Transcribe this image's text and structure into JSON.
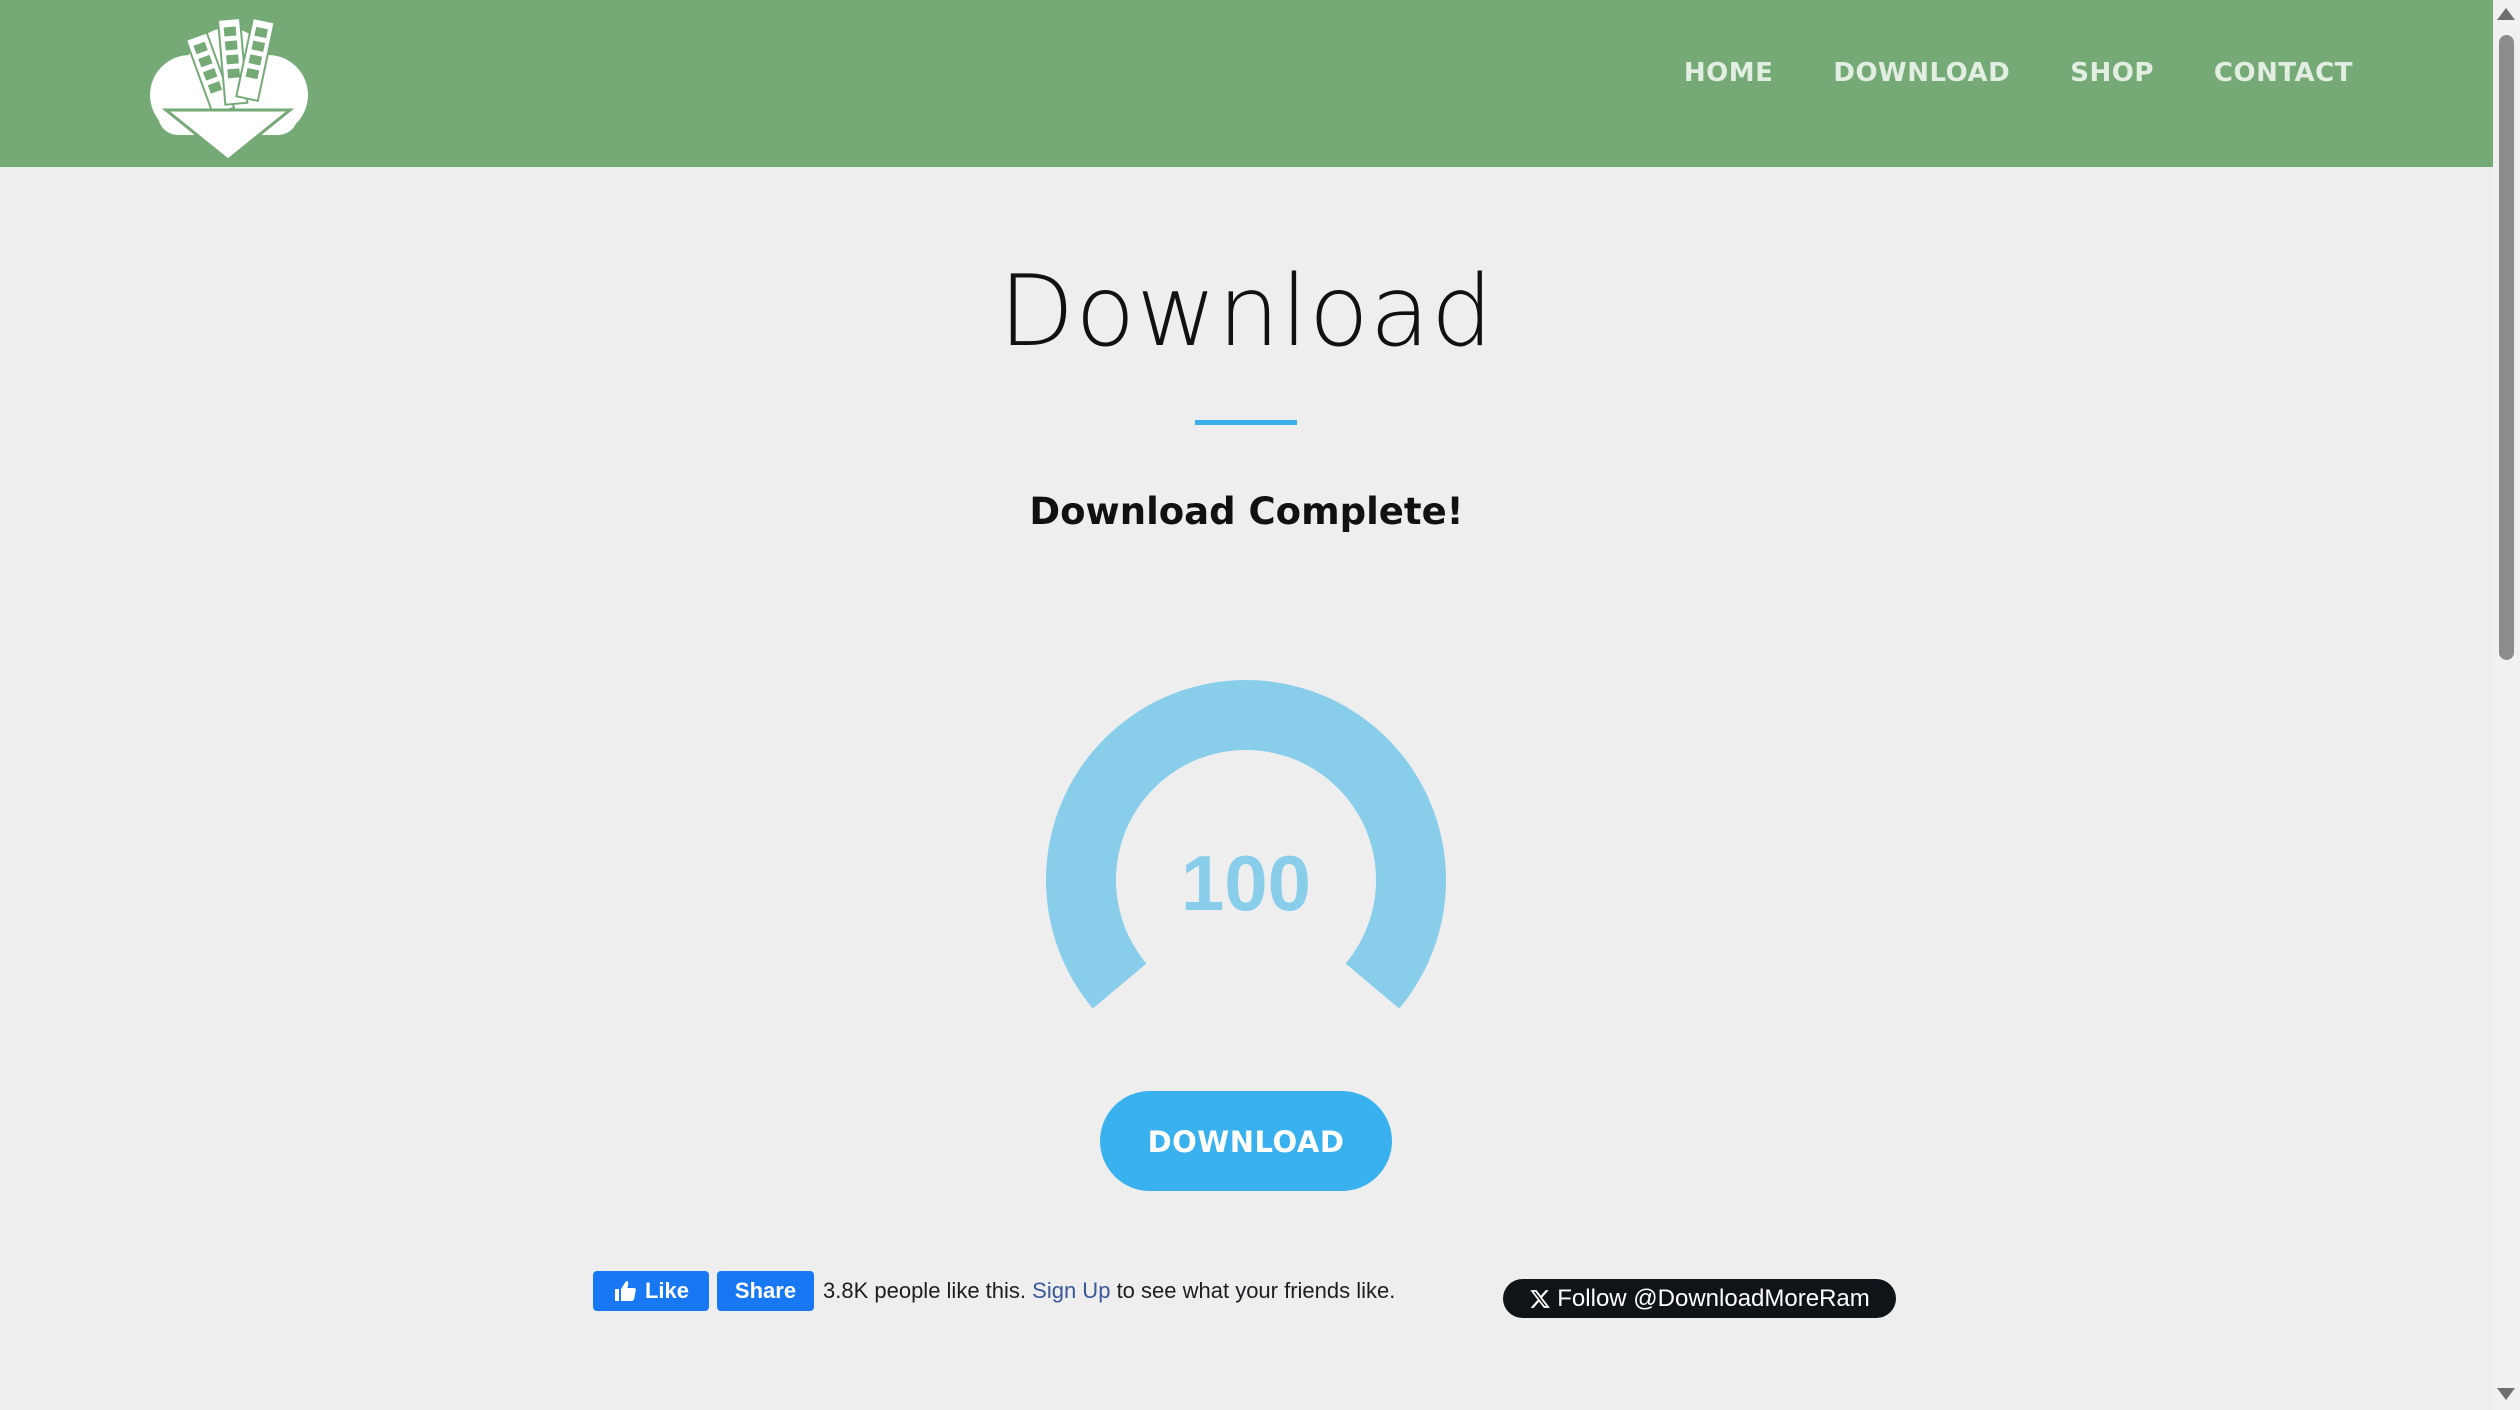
{
  "header": {
    "logo_icon": "ram-download-cloud-icon",
    "bg_color": "#75aa77",
    "nav": [
      {
        "label": "HOME"
      },
      {
        "label": "DOWNLOAD"
      },
      {
        "label": "SHOP"
      },
      {
        "label": "CONTACT"
      }
    ]
  },
  "main": {
    "title": "Download",
    "accent_color": "#3bafe9",
    "status": "Download Complete!",
    "gauge": {
      "value": "100",
      "progress_percent": 100,
      "color": "#88cdea"
    },
    "download_button_label": "DOWNLOAD"
  },
  "social": {
    "fb_like_label": "Like",
    "fb_share_label": "Share",
    "fb_count_text": "3.8K people like this.",
    "fb_signup_link": "Sign Up",
    "fb_suffix_text": "to see what your friends like.",
    "x_follow_label": "Follow @DownloadMoreRam"
  }
}
